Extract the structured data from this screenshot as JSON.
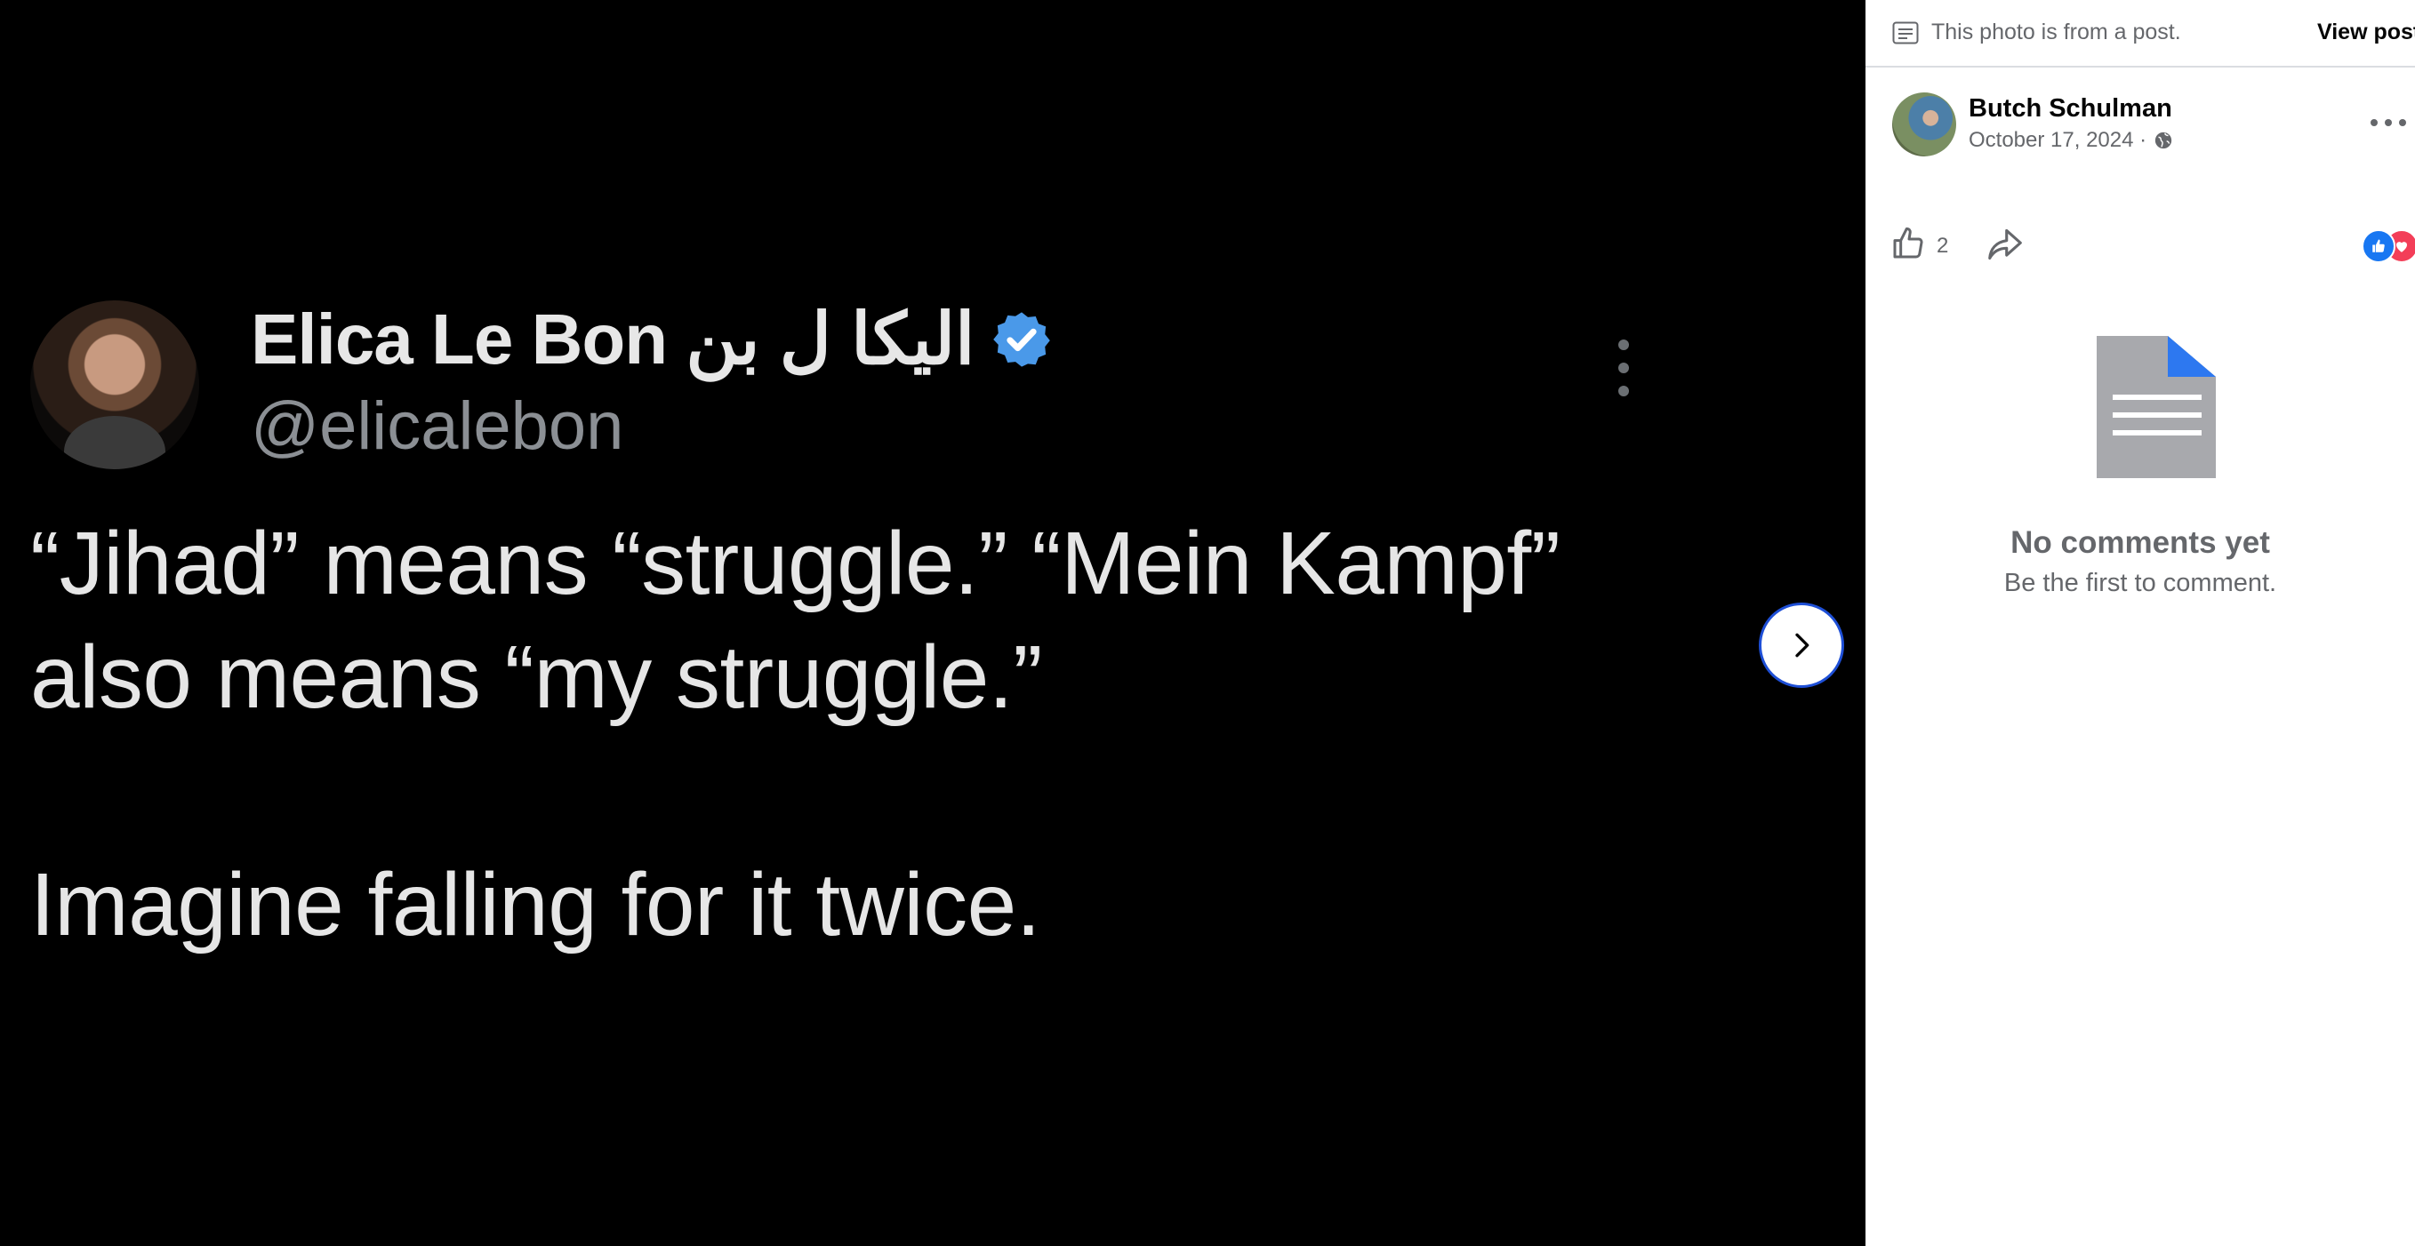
{
  "photo": {
    "tweet": {
      "display_name": "Elica Le Bon اليكا ل بن",
      "handle": "@elicalebon",
      "text_line1": "“Jihad” means “struggle.” “Mein Kampf”",
      "text_line2": "also means “my struggle.”",
      "text_line3": "Imagine falling for it twice."
    },
    "next_button_icon": "chevron-right-icon"
  },
  "panel": {
    "notice_text": "This photo is from a post.",
    "view_post_label": "View post",
    "author_name": "Butch Schulman",
    "post_date": "October 17, 2024 ·",
    "like_count": "2",
    "reactions": [
      "like",
      "love"
    ],
    "no_comments_title": "No comments yet",
    "no_comments_subtitle": "Be the first to comment."
  },
  "colors": {
    "accent_blue": "#1877f2",
    "love_red": "#f33e58",
    "verified_blue": "#4a99e9",
    "secondary_text": "#65676b"
  }
}
